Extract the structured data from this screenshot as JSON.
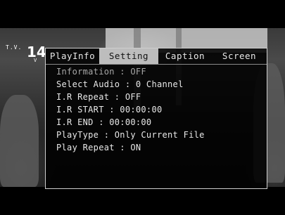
{
  "channel": {
    "icon": "tv-icon",
    "tv_label": "T.V.",
    "number": "14",
    "sub": "V"
  },
  "menu": {
    "tabs": [
      {
        "label": "PlayInfo",
        "active": false
      },
      {
        "label": "Setting",
        "active": true
      },
      {
        "label": "Caption",
        "active": false
      },
      {
        "label": "Screen",
        "active": false
      }
    ],
    "items": [
      {
        "text": "Information : OFF"
      },
      {
        "text": "Select Audio : 0 Channel"
      },
      {
        "text": "I.R Repeat : OFF"
      },
      {
        "text": "I.R START : 00:00:00"
      },
      {
        "text": "I.R END : 00:00:00"
      },
      {
        "text": "PlayType : Only Current File"
      },
      {
        "text": "Play Repeat : ON"
      }
    ]
  },
  "colors": {
    "panel_bg": "#000000",
    "panel_border": "#cfcfcf",
    "active_tab_bg": "#bdbdbd",
    "text": "#e8e8e8"
  }
}
